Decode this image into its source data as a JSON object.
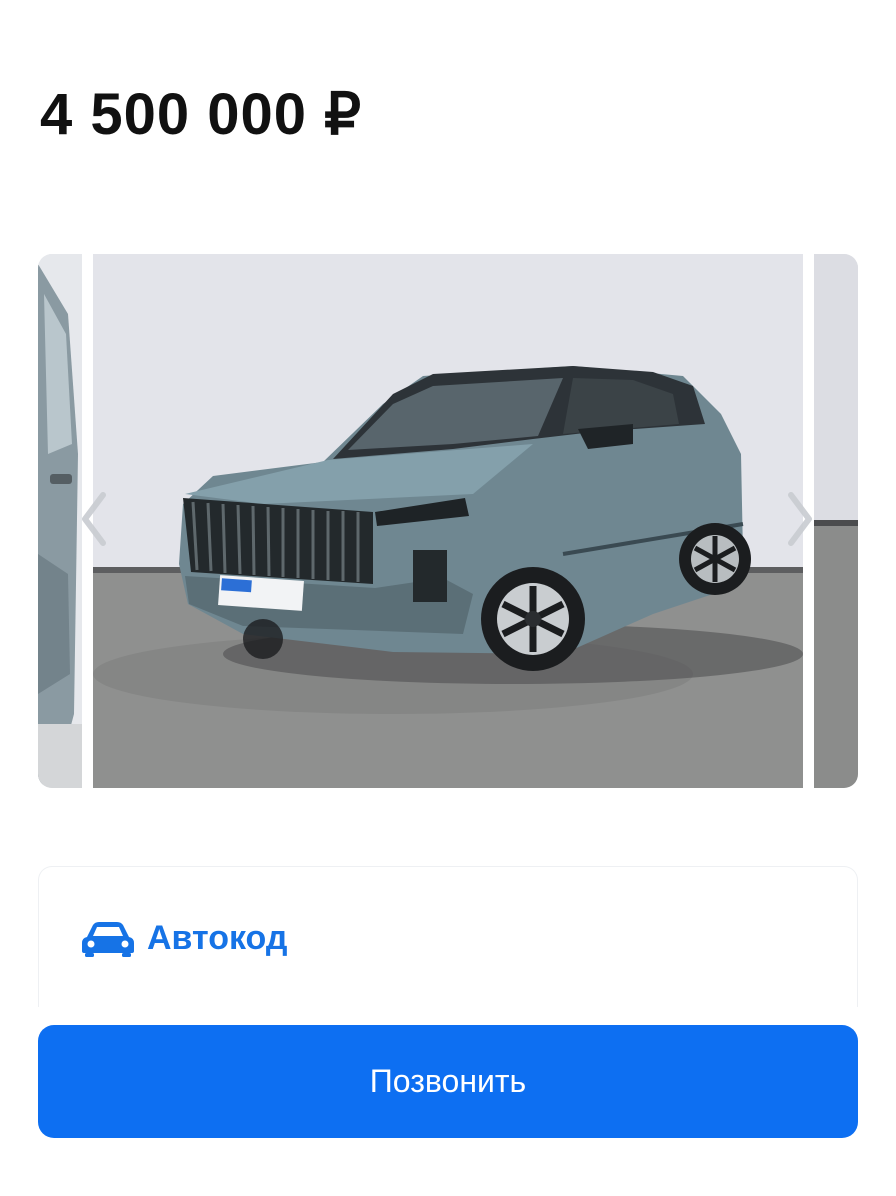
{
  "listing": {
    "price": "4 500 000 ₽"
  },
  "gallery": {
    "prev_icon": "chevron-left-icon",
    "next_icon": "chevron-right-icon"
  },
  "seller": {
    "icon": "car-icon",
    "name": "Автокод"
  },
  "actions": {
    "call_label": "Позвонить"
  },
  "colors": {
    "accent": "#0d6ff2",
    "seller_text": "#1673e6",
    "price_text": "#111111"
  }
}
